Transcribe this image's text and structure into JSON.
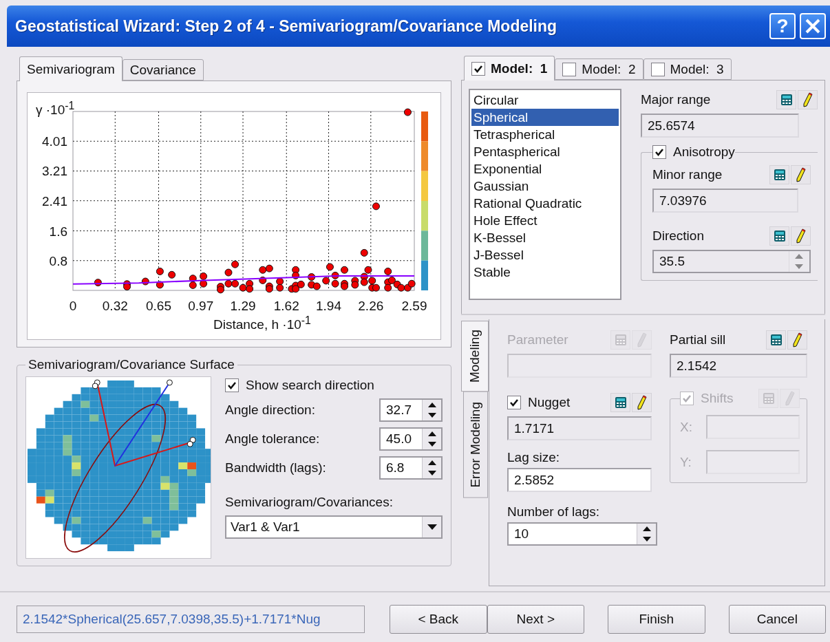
{
  "window": {
    "title": "Geostatistical Wizard: Step 2 of 4 - Semivariogram/Covariance Modeling",
    "help": "?"
  },
  "chart_tabs": [
    {
      "label": "Semivariogram",
      "selected": true
    },
    {
      "label": "Covariance",
      "selected": false
    }
  ],
  "chart": {
    "chart_data": {
      "type": "scatter",
      "xlabel": "Distance, h ·10$^{-1}$",
      "ylabel": "γ ·10$^{-1}$",
      "xlim": [
        0,
        2.59
      ],
      "ylim": [
        0,
        4.81
      ],
      "xticks": [
        0,
        0.32,
        0.65,
        0.97,
        1.29,
        1.62,
        1.94,
        2.26,
        2.59
      ],
      "yticks": [
        0.8,
        1.6,
        2.41,
        3.21,
        4.01
      ],
      "x": [
        0.19,
        0.41,
        0.41,
        0.55,
        0.66,
        0.66,
        0.75,
        0.91,
        0.91,
        0.99,
        0.99,
        1.12,
        1.12,
        1.18,
        1.18,
        1.23,
        1.23,
        1.29,
        1.34,
        1.34,
        1.44,
        1.44,
        1.49,
        1.49,
        1.49,
        1.57,
        1.57,
        1.66,
        1.69,
        1.69,
        1.69,
        1.69,
        1.73,
        1.81,
        1.81,
        1.85,
        1.92,
        1.95,
        1.99,
        1.99,
        2.06,
        2.06,
        2.06,
        2.14,
        2.14,
        2.21,
        2.21,
        2.21,
        2.24,
        2.27,
        2.27,
        2.3,
        2.3,
        2.39,
        2.39,
        2.39,
        2.42,
        2.46,
        2.49,
        2.54,
        2.54,
        2.57
      ],
      "grid": true,
      "series": [
        {
          "color": "#ee0000",
          "values": [
            0.21,
            0.17,
            0.1,
            0.24,
            0.51,
            0.15,
            0.42,
            0.32,
            0.14,
            0.38,
            0.18,
            0.1,
            0.02,
            0.48,
            0.18,
            0.7,
            0.18,
            0.07,
            0.18,
            0.04,
            0.55,
            0.27,
            0.59,
            0.11,
            0.04,
            0.24,
            0.07,
            0.04,
            0.55,
            0.4,
            0.13,
            0.04,
            0.16,
            0.36,
            0.15,
            0.11,
            0.26,
            0.63,
            0.4,
            0.18,
            0.55,
            0.18,
            0.11,
            0.26,
            0.15,
            1.01,
            0.37,
            0.22,
            0.55,
            0.26,
            0.07,
            2.26,
            0.07,
            0.51,
            0.22,
            0.07,
            0.27,
            0.16,
            0.07,
            4.79,
            0.07,
            0.18
          ]
        },
        {
          "type": "line",
          "color": "#8800ff",
          "x": [
            0,
            0.5,
            1,
            1.5,
            2,
            2.59
          ],
          "values": [
            0.17,
            0.2,
            0.27,
            0.33,
            0.39,
            0.39
          ]
        }
      ]
    }
  },
  "surface": {
    "title": "Semivariogram/Covariance Surface",
    "show_search_direction": {
      "label": "Show search direction",
      "checked": true
    },
    "spinners": [
      {
        "label": "Angle direction:",
        "value": "32.7"
      },
      {
        "label": "Angle tolerance:",
        "value": "45.0"
      },
      {
        "label": "Bandwidth (lags):",
        "value": "6.8"
      }
    ],
    "select": {
      "label": "Semivariogram/Covariances:",
      "value": "Var1 & Var1"
    }
  },
  "model_tabs": [
    {
      "label": "Model:  1",
      "checked": true,
      "selected": true
    },
    {
      "label": "Model:  2",
      "checked": false,
      "selected": false
    },
    {
      "label": "Model:  3",
      "checked": false,
      "selected": false
    }
  ],
  "model_types": [
    {
      "label": "Circular",
      "selected": false
    },
    {
      "label": "Spherical",
      "selected": true
    },
    {
      "label": "Tetraspherical",
      "selected": false
    },
    {
      "label": "Pentaspherical",
      "selected": false
    },
    {
      "label": "Exponential",
      "selected": false
    },
    {
      "label": "Gaussian",
      "selected": false
    },
    {
      "label": "Rational Quadratic",
      "selected": false
    },
    {
      "label": "Hole Effect",
      "selected": false
    },
    {
      "label": "K-Bessel",
      "selected": false
    },
    {
      "label": "J-Bessel",
      "selected": false
    },
    {
      "label": "Stable",
      "selected": false
    }
  ],
  "major_range": {
    "label": "Major range",
    "value": "25.6574"
  },
  "anisotropy": {
    "label": "Anisotropy",
    "checked": true
  },
  "minor_range": {
    "label": "Minor range",
    "value": "7.03976"
  },
  "direction": {
    "label": "Direction",
    "value": "35.5"
  },
  "side_tabs": [
    {
      "label": "Modeling",
      "selected": true
    },
    {
      "label": "Error Modeling",
      "selected": false
    }
  ],
  "parameter": {
    "label": "Parameter",
    "disabled": true
  },
  "partial_sill": {
    "label": "Partial sill",
    "value": "2.1542"
  },
  "nugget": {
    "label": "Nugget",
    "checked": true,
    "value": "1.7171"
  },
  "shifts": {
    "label": "Shifts",
    "checked": true,
    "disabled": true,
    "x_label": "X:",
    "y_label": "Y:"
  },
  "lag_size": {
    "label": "Lag size:",
    "value": "2.5852"
  },
  "number_of_lags": {
    "label": "Number of lags:",
    "value": "10"
  },
  "formula": "2.1542*Spherical(25.657,7.0398,35.5)+1.7171*Nug",
  "buttons": [
    "< Back",
    "Next >",
    "Finish",
    "Cancel"
  ]
}
